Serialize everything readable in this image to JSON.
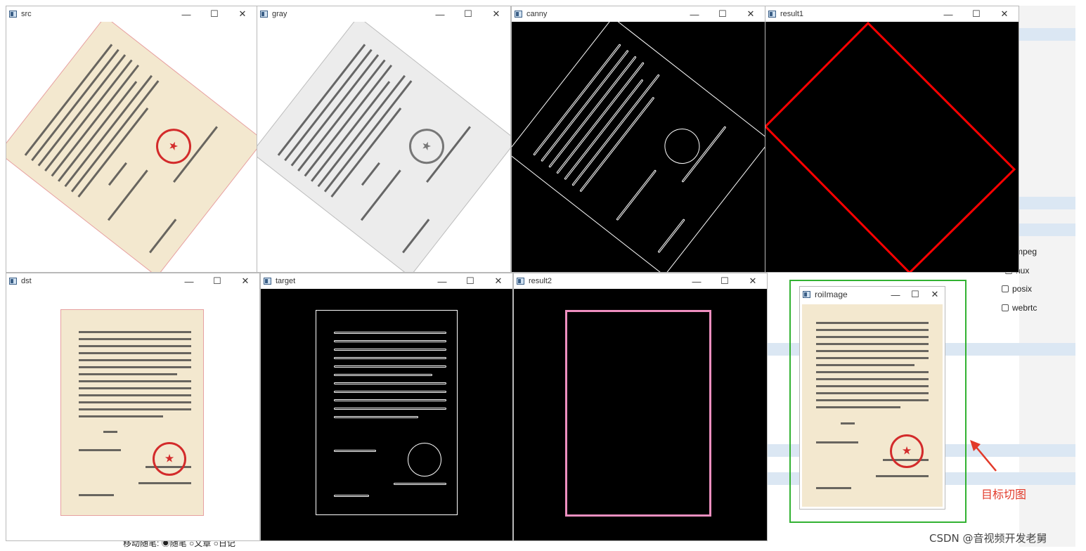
{
  "windows": {
    "src": {
      "title": "src"
    },
    "gray": {
      "title": "gray"
    },
    "canny": {
      "title": "canny"
    },
    "result1": {
      "title": "result1"
    },
    "dst": {
      "title": "dst"
    },
    "target": {
      "title": "target"
    },
    "result2": {
      "title": "result2"
    },
    "roi": {
      "title": "roiImage"
    }
  },
  "controls": {
    "minimize": "—",
    "maximize": "☐",
    "close": "✕"
  },
  "background": {
    "checkboxes": [
      "mpeg",
      "nux",
      "posix",
      "webrtc"
    ]
  },
  "annotation": {
    "label": "目标切图"
  },
  "watermark": "CSDN @音视频开发老舅",
  "bottom_bar": {
    "text": "移动随笔: ◉随笔 ○文章 ○日记"
  },
  "colors": {
    "red": "#ff0000",
    "pink": "#ee8fc0",
    "green": "#32b232",
    "annotation": "#e23a2a"
  }
}
